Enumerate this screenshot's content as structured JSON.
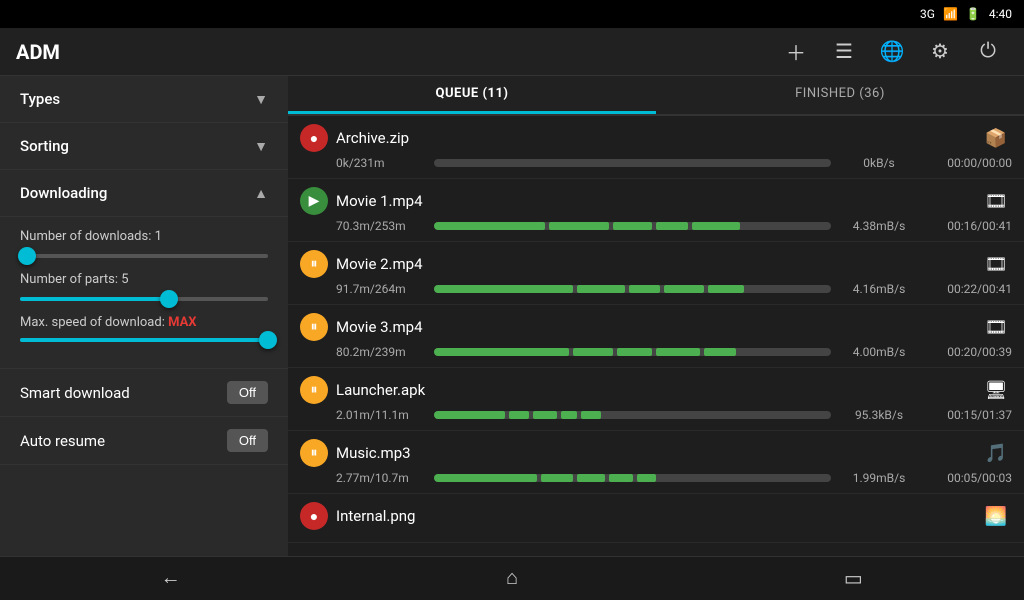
{
  "statusBar": {
    "network": "3G",
    "signal": "▲▲▲",
    "battery": "🔋",
    "time": "4:40"
  },
  "header": {
    "title": "ADM",
    "actions": [
      "add",
      "menu",
      "globe",
      "equalizer",
      "power"
    ]
  },
  "sidebar": {
    "types_label": "Types",
    "sorting_label": "Sorting",
    "downloading_label": "Downloading",
    "num_downloads_label": "Number of downloads: 1",
    "num_downloads_value": 1,
    "num_downloads_pct": 3,
    "num_parts_label": "Number of parts: 5",
    "num_parts_value": 5,
    "num_parts_pct": 60,
    "max_speed_label": "Max. speed of download: ",
    "max_speed_value": "MAX",
    "max_speed_pct": 100,
    "smart_download_label": "Smart download",
    "smart_download_value": "Off",
    "auto_resume_label": "Auto resume",
    "auto_resume_value": "Off"
  },
  "tabs": [
    {
      "label": "QUEUE (11)",
      "active": true
    },
    {
      "label": "FINISHED (36)",
      "active": false
    }
  ],
  "downloads": [
    {
      "name": "Archive.zip",
      "icon_type": "red",
      "icon_symbol": "●",
      "thumb": "📦",
      "size": "0k/231m",
      "speed": "0kB/s",
      "time": "00:00/00:00",
      "progress_pct": 0,
      "chunks": []
    },
    {
      "name": "Movie 1.mp4",
      "icon_type": "green",
      "icon_symbol": "▶",
      "thumb": "🎞",
      "size": "70.3m/253m",
      "speed": "4.38mB/s",
      "time": "00:16/00:41",
      "progress_pct": 28,
      "chunks": [
        28,
        15,
        10,
        8,
        12
      ]
    },
    {
      "name": "Movie 2.mp4",
      "icon_type": "pause",
      "icon_symbol": "⏸",
      "thumb": "🎞",
      "size": "91.7m/264m",
      "speed": "4.16mB/s",
      "time": "00:22/00:41",
      "progress_pct": 35,
      "chunks": [
        35,
        12,
        8,
        10,
        9
      ]
    },
    {
      "name": "Movie 3.mp4",
      "icon_type": "pause",
      "icon_symbol": "⏸",
      "thumb": "🎞",
      "size": "80.2m/239m",
      "speed": "4.00mB/s",
      "time": "00:20/00:39",
      "progress_pct": 34,
      "chunks": [
        34,
        10,
        9,
        11,
        8
      ]
    },
    {
      "name": "Launcher.apk",
      "icon_type": "pause",
      "icon_symbol": "⏸",
      "thumb": "🖥",
      "size": "2.01m/11.1m",
      "speed": "95.3kB/s",
      "time": "00:15/01:37",
      "progress_pct": 18,
      "chunks": [
        18,
        5,
        6,
        4,
        5
      ]
    },
    {
      "name": "Music.mp3",
      "icon_type": "pause",
      "icon_symbol": "⏸",
      "thumb": "🎵",
      "size": "2.77m/10.7m",
      "speed": "1.99mB/s",
      "time": "00:05/00:03",
      "progress_pct": 26,
      "chunks": [
        26,
        8,
        7,
        6,
        5
      ]
    },
    {
      "name": "Internal.png",
      "icon_type": "red",
      "icon_symbol": "●",
      "thumb": "🌅",
      "size": "",
      "speed": "",
      "time": "",
      "progress_pct": 0,
      "chunks": []
    }
  ],
  "bottomNav": {
    "back": "←",
    "home": "⌂",
    "recents": "▭"
  }
}
